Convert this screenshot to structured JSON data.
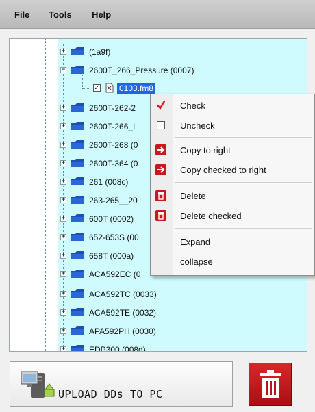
{
  "menubar": {
    "file": "File",
    "tools": "Tools",
    "help": "Help"
  },
  "tree": {
    "items": [
      {
        "label": "(1a9f)",
        "expanded": false
      },
      {
        "label": "2600T_266_Pressure (0007)",
        "expanded": true
      },
      {
        "label": "2600T-262-2",
        "expanded": false
      },
      {
        "label": "2600T-266_I",
        "expanded": false
      },
      {
        "label": "2600T-268 (0",
        "expanded": false
      },
      {
        "label": "2600T-364 (0",
        "expanded": false
      },
      {
        "label": "261 (008c)",
        "expanded": false
      },
      {
        "label": "263-265__20",
        "expanded": false
      },
      {
        "label": "600T (0002)",
        "expanded": false
      },
      {
        "label": "652-653S (00",
        "expanded": false
      },
      {
        "label": "658T (000a)",
        "expanded": false
      },
      {
        "label": "ACA592EC (0",
        "expanded": false
      },
      {
        "label": "ACA592TC (0033)",
        "expanded": false
      },
      {
        "label": "ACA592TE (0032)",
        "expanded": false
      },
      {
        "label": "APA592PH (0030)",
        "expanded": false
      },
      {
        "label": "EDP300 (008d)",
        "expanded": false
      }
    ],
    "child": {
      "label": "0103.fm8",
      "checked": true
    }
  },
  "context_menu": {
    "items": [
      {
        "label": "Check",
        "icon": "checkmark-icon"
      },
      {
        "label": "Uncheck",
        "icon": "empty-checkbox-icon"
      },
      {
        "label": "Copy to right",
        "icon": "arrow-right-icon"
      },
      {
        "label": "Copy checked to right",
        "icon": "arrow-right-icon"
      },
      {
        "label": "Delete",
        "icon": "trash-icon"
      },
      {
        "label": "Delete checked",
        "icon": "trash-icon"
      },
      {
        "label": "Expand",
        "icon": ""
      },
      {
        "label": "collapse",
        "icon": ""
      }
    ]
  },
  "buttons": {
    "upload_label": "UPLOAD DDs TO PC",
    "upload_icon": "computer-upload-icon",
    "delete_icon": "trash-icon"
  },
  "colors": {
    "tree_background": "#cffbff",
    "selection": "#1f66e6",
    "danger_red": "#c8181e",
    "folder_blue": "#1d4fb8"
  }
}
